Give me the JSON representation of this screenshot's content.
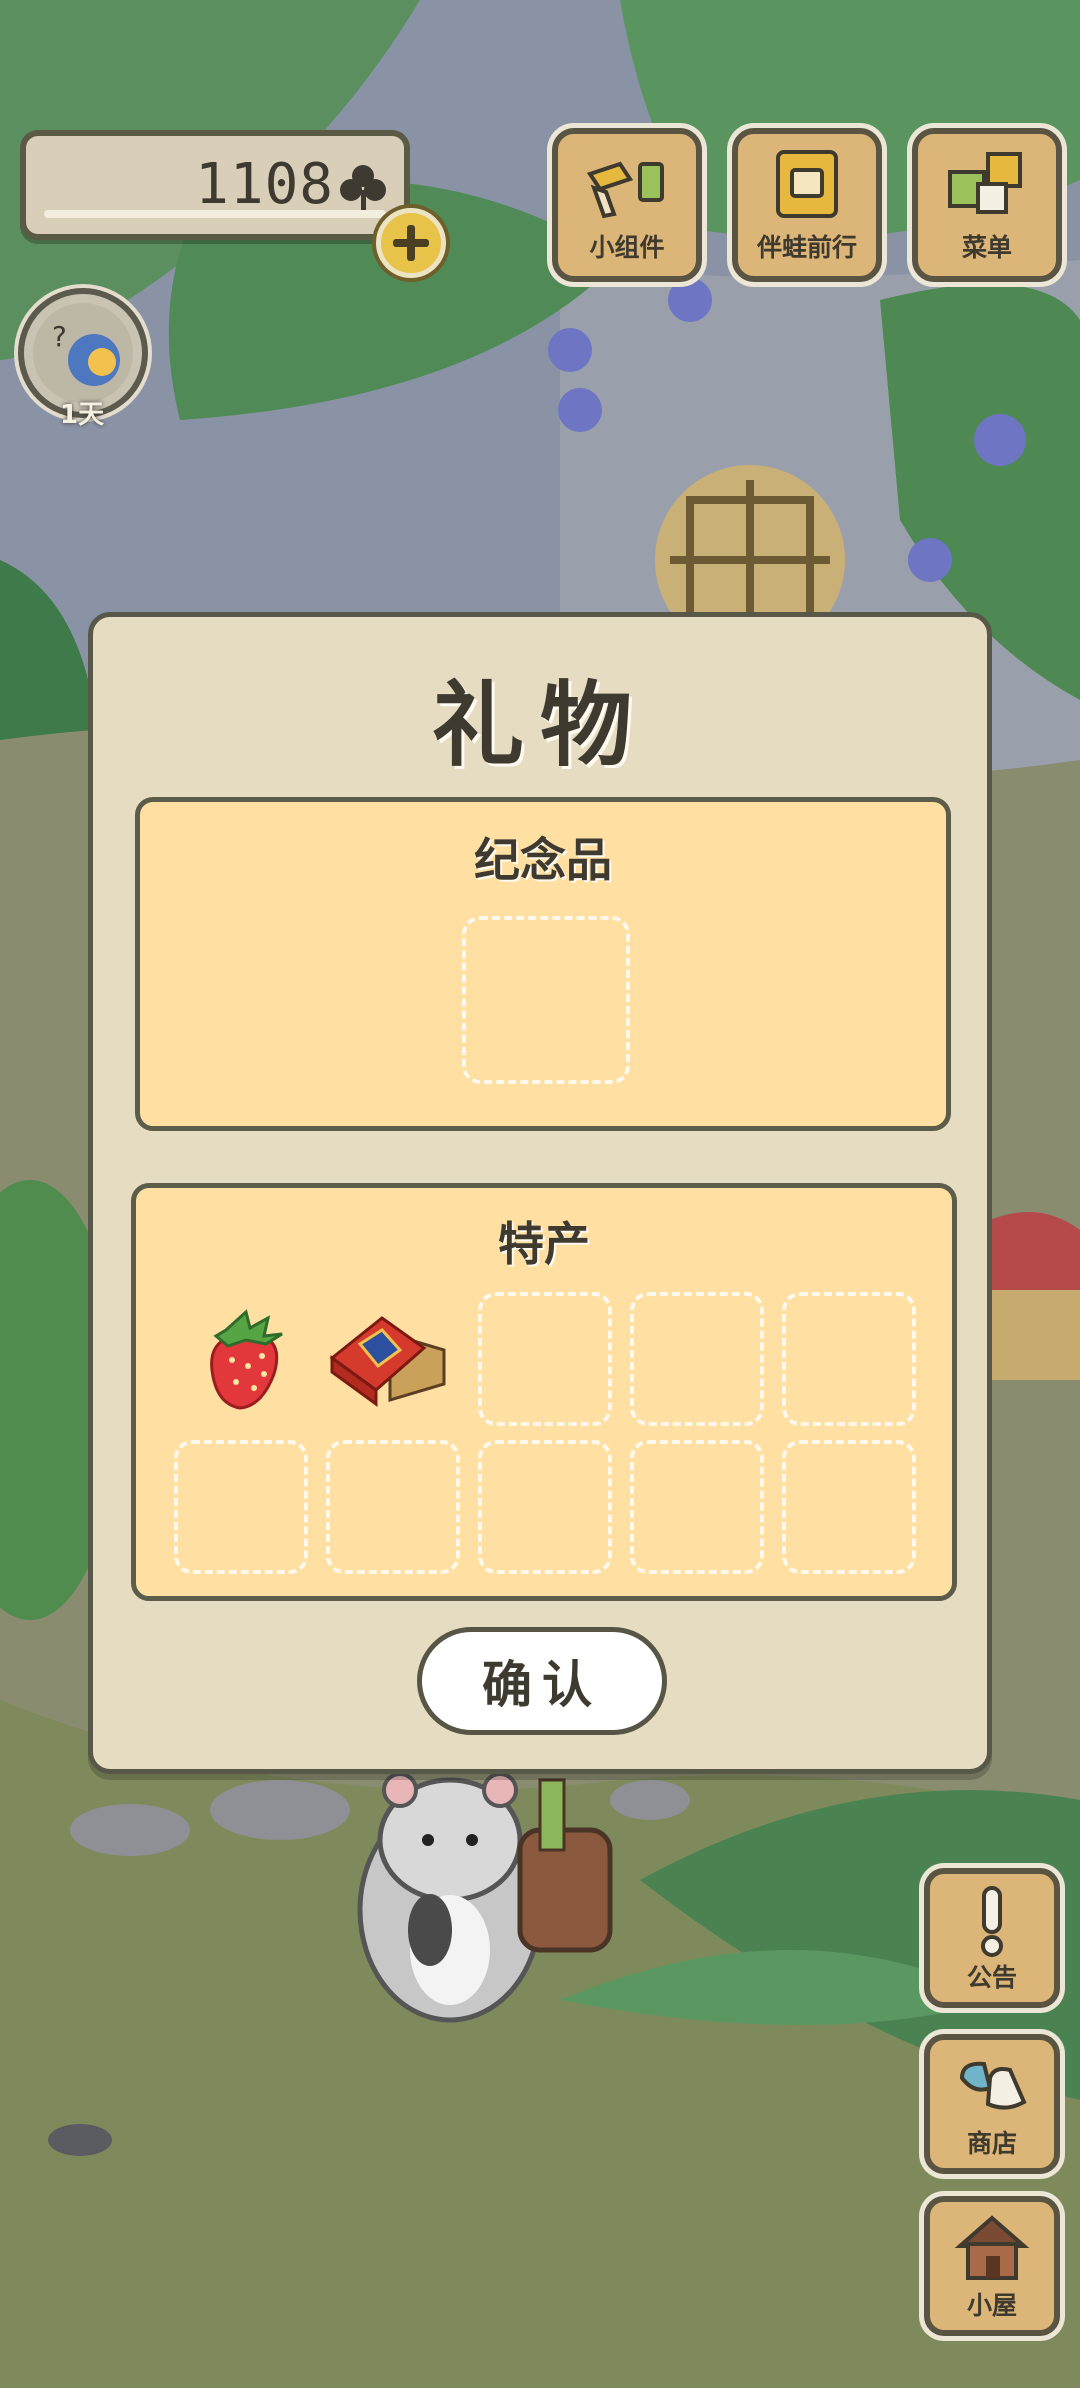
{
  "header": {
    "clover_count": "1108",
    "days_label": "1天"
  },
  "top_menu": [
    {
      "label": "小组件",
      "icon": "widget-icon"
    },
    {
      "label": "伴蛙前行",
      "icon": "journey-book-icon"
    },
    {
      "label": "菜单",
      "icon": "menu-cards-icon"
    }
  ],
  "gift_dialog": {
    "title": "礼物",
    "souvenir_section": {
      "title": "纪念品"
    },
    "specialty_section": {
      "title": "特产",
      "items": [
        {
          "name": "strawberry",
          "icon": "strawberry-icon"
        },
        {
          "name": "gift box",
          "icon": "gift-box-icon"
        }
      ]
    },
    "confirm_label": "确认"
  },
  "side_menu": [
    {
      "label": "公告",
      "icon": "notice-icon"
    },
    {
      "label": "商店",
      "icon": "shop-bags-icon"
    },
    {
      "label": "小屋",
      "icon": "house-icon"
    }
  ],
  "colors": {
    "dialog_bg": "#e5dcc1",
    "section_bg": "#ffe0a2",
    "button_wood": "#dcb578",
    "outline": "#585848"
  }
}
